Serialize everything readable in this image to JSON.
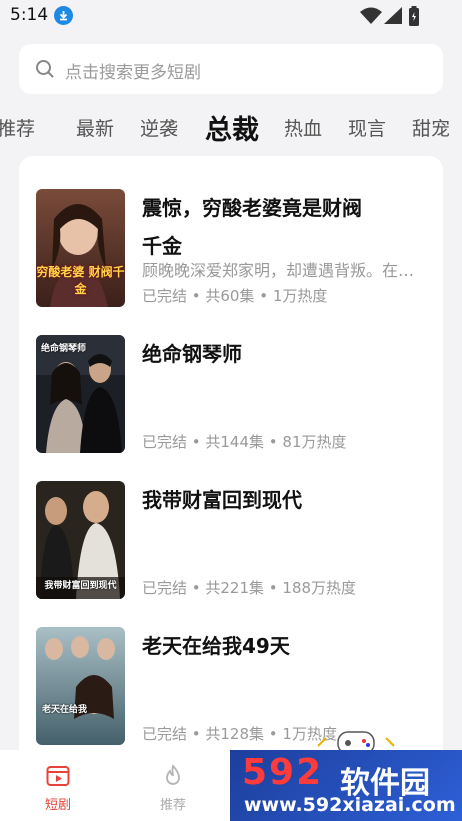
{
  "status_bar": {
    "time": "5:14"
  },
  "search": {
    "placeholder": "点击搜索更多短剧"
  },
  "tabs": [
    {
      "label": "推荐",
      "visible_label": "推荐"
    },
    {
      "label": "最新"
    },
    {
      "label": "逆袭"
    },
    {
      "label": "总裁",
      "active": true
    },
    {
      "label": "热血"
    },
    {
      "label": "现言"
    },
    {
      "label": "甜宠"
    }
  ],
  "dramas": [
    {
      "title": "震惊，穷酸老婆竟是财阀千金",
      "desc": "顾晚晚深爱郑家明，却遭遇背叛。在遭...",
      "meta": "已完结 • 共60集 • 1万热度",
      "poster_text": "穷酸老婆 财阀千金"
    },
    {
      "title": "绝命钢琴师",
      "desc": "",
      "meta": "已完结 • 共144集 • 81万热度",
      "poster_text": "绝命钢琴师"
    },
    {
      "title": "我带财富回到现代",
      "desc": "",
      "meta": "已完结 • 共221集 • 188万热度",
      "poster_text": "我带财富回到现代"
    },
    {
      "title": "老天在给我49天",
      "desc": "",
      "meta": "已完结 • 共128集 • 1万热度",
      "poster_text": "老天在给我"
    }
  ],
  "bottom_nav": [
    {
      "label": "短剧",
      "active": true
    },
    {
      "label": "推荐"
    }
  ],
  "watermark": {
    "logo": "592",
    "cn": "软件园",
    "url": "www.592xiazai.com"
  },
  "colors": {
    "accent": "#e8433a",
    "background": "#f3f3f5"
  }
}
